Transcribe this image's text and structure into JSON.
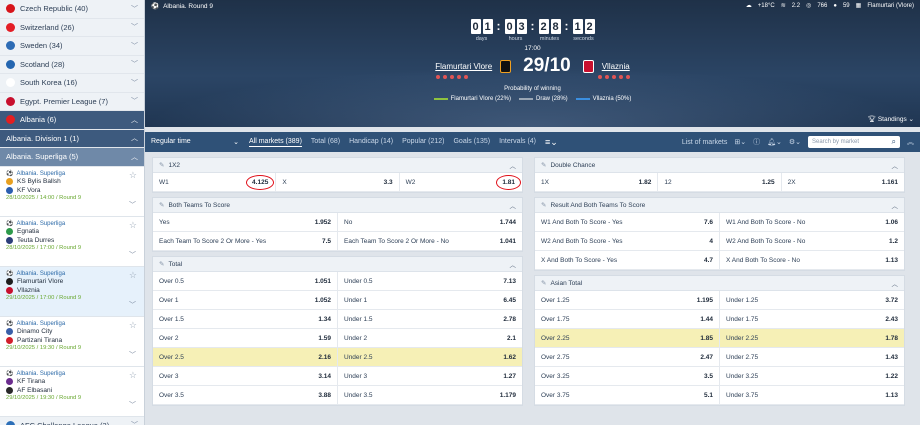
{
  "sidebar": {
    "countries_top": [
      {
        "label": "Czech Republic (40)",
        "color": "#d7141a"
      },
      {
        "label": "Switzerland (26)",
        "color": "#e41e26"
      },
      {
        "label": "Sweden (34)",
        "color": "#2d6cb5"
      },
      {
        "label": "Scotland (28)",
        "color": "#2466b0"
      },
      {
        "label": "South Korea (16)",
        "color": "#ffffff"
      },
      {
        "label": "Egypt. Premier League (7)",
        "color": "#c8102e"
      }
    ],
    "albania": {
      "label": "Albania (6)",
      "color": "#e41e20"
    },
    "division": {
      "label": "Albania. Division 1 (1)"
    },
    "superliga": {
      "label": "Albania. Superliga (5)"
    },
    "matches": [
      {
        "league": "Albania. Superliga",
        "home": "KS Bylis Ballsh",
        "away": "KF Vora",
        "time": "28/10/2025 / 14:00 / Round 9",
        "home_color": "#e8a020",
        "away_color": "#2b5fb0"
      },
      {
        "league": "Albania. Superliga",
        "home": "Egnatia",
        "away": "Teuta Durres",
        "time": "28/10/2025 / 17:00 / Round 9",
        "home_color": "#2e9a4b",
        "away_color": "#2c3f7a"
      },
      {
        "league": "Albania. Superliga",
        "home": "Flamurtari Vlore",
        "away": "Vllaznia",
        "time": "29/10/2025 / 17:00 / Round 9",
        "home_color": "#1e1e1e",
        "away_color": "#c8102e"
      },
      {
        "league": "Albania. Superliga",
        "home": "Dinamo City",
        "away": "Partizani Tirana",
        "time": "29/10/2025 / 19:30 / Round 9",
        "home_color": "#3a5fa8",
        "away_color": "#d21f2b"
      },
      {
        "league": "Albania. Superliga",
        "home": "KF Tirana",
        "away": "AF Elbasani",
        "time": "29/10/2025 / 19:30 / Round 9",
        "home_color": "#6b2c8e",
        "away_color": "#2a2a2a"
      }
    ],
    "afc": {
      "label": "AFC Challenge League (3)",
      "color": "#2c6fb8"
    }
  },
  "hero": {
    "breadcrumb": "Albania. Round 9",
    "weather": {
      "temp": "+18°C",
      "wind": "2.2",
      "pressure": "766",
      "humidity": "59",
      "venue": "Flamurtari (Vlore)"
    },
    "timer": {
      "days": "01",
      "hours": "03",
      "minutes": "28",
      "seconds": "12"
    },
    "timer_labels": {
      "days": "days",
      "hours": "hours",
      "minutes": "minutes",
      "seconds": "seconds"
    },
    "kickoff": "17:00",
    "home": "Flamurtari Vlore",
    "away": "Vllaznia",
    "date": "29/10",
    "home_form": [
      "#e05555",
      "#e05555",
      "#e05555",
      "#e05555",
      "#e05555"
    ],
    "away_form": [
      "#e05555",
      "#e05555",
      "#e05555",
      "#e05555",
      "#e05555"
    ],
    "prob_title": "Probability of winning",
    "prob": [
      {
        "label": "Flamurtari Vlore (22%)",
        "color": "#8fc23f"
      },
      {
        "label": "Draw (28%)",
        "color": "#9aa7b5"
      },
      {
        "label": "Vllaznia (50%)",
        "color": "#3b8fe0"
      }
    ],
    "standings": "Standings"
  },
  "filter": {
    "regular": "Regular time",
    "tabs": [
      "All markets (389)",
      "Total (68)",
      "Handicap (14)",
      "Popular (212)",
      "Goals (135)",
      "Intervals (4)"
    ],
    "list_of_markets": "List of markets",
    "search_placeholder": "Search by market"
  },
  "markets_left": [
    {
      "title": "1X2",
      "rows": [
        [
          [
            "W1",
            "4.125"
          ],
          [
            "X",
            "3.3"
          ],
          [
            "W2",
            "1.81"
          ]
        ]
      ]
    },
    {
      "title": "Both Teams To Score",
      "rows": [
        [
          [
            "Yes",
            "1.952"
          ],
          [
            "No",
            "1.744"
          ]
        ],
        [
          [
            "Each Team To Score 2 Or More - Yes",
            "7.5"
          ],
          [
            "Each Team To Score 2 Or More - No",
            "1.041"
          ]
        ]
      ]
    },
    {
      "title": "Total",
      "rows": [
        [
          [
            "Over 0.5",
            "1.051"
          ],
          [
            "Under 0.5",
            "7.13"
          ]
        ],
        [
          [
            "Over 1",
            "1.052"
          ],
          [
            "Under 1",
            "6.45"
          ]
        ],
        [
          [
            "Over 1.5",
            "1.34"
          ],
          [
            "Under 1.5",
            "2.78"
          ]
        ],
        [
          [
            "Over 2",
            "1.59"
          ],
          [
            "Under 2",
            "2.1"
          ]
        ],
        [
          [
            "Over 2.5",
            "2.16"
          ],
          [
            "Under 2.5",
            "1.62"
          ]
        ],
        [
          [
            "Over 3",
            "3.14"
          ],
          [
            "Under 3",
            "1.27"
          ]
        ],
        [
          [
            "Over 3.5",
            "3.88"
          ],
          [
            "Under 3.5",
            "1.179"
          ]
        ]
      ],
      "highlight_row": 4
    }
  ],
  "markets_right": [
    {
      "title": "Double Chance",
      "rows": [
        [
          [
            "1X",
            "1.82"
          ],
          [
            "12",
            "1.25"
          ],
          [
            "2X",
            "1.161"
          ]
        ]
      ]
    },
    {
      "title": "Result And Both Teams To Score",
      "rows": [
        [
          [
            "W1 And Both To Score - Yes",
            "7.6"
          ],
          [
            "W1 And Both To Score - No",
            "1.06"
          ]
        ],
        [
          [
            "W2 And Both To Score - Yes",
            "4"
          ],
          [
            "W2 And Both To Score - No",
            "1.2"
          ]
        ],
        [
          [
            "X And Both To Score - Yes",
            "4.7"
          ],
          [
            "X And Both To Score - No",
            "1.13"
          ]
        ]
      ]
    },
    {
      "title": "Asian Total",
      "rows": [
        [
          [
            "Over 1.25",
            "1.195"
          ],
          [
            "Under 1.25",
            "3.72"
          ]
        ],
        [
          [
            "Over 1.75",
            "1.44"
          ],
          [
            "Under 1.75",
            "2.43"
          ]
        ],
        [
          [
            "Over 2.25",
            "1.85"
          ],
          [
            "Under 2.25",
            "1.78"
          ]
        ],
        [
          [
            "Over 2.75",
            "2.47"
          ],
          [
            "Under 2.75",
            "1.43"
          ]
        ],
        [
          [
            "Over 3.25",
            "3.5"
          ],
          [
            "Under 3.25",
            "1.22"
          ]
        ],
        [
          [
            "Over 3.75",
            "5.1"
          ],
          [
            "Under 3.75",
            "1.13"
          ]
        ]
      ],
      "highlight_row": 2
    }
  ]
}
